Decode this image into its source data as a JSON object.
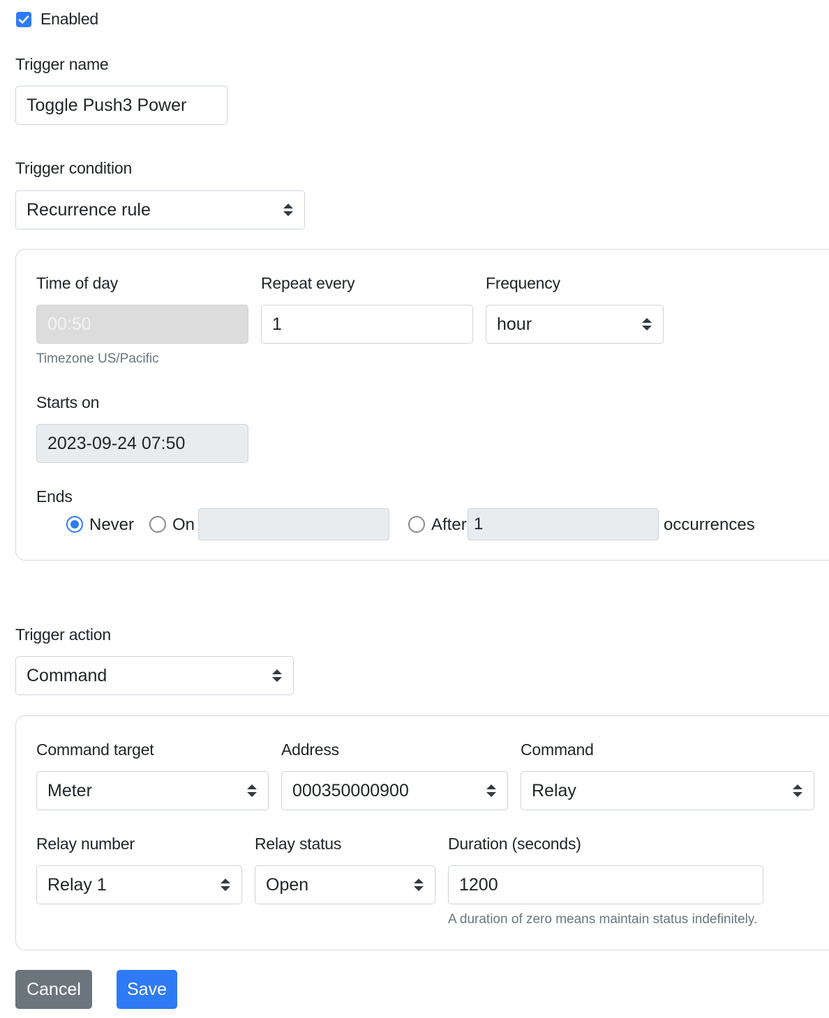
{
  "enabled": {
    "label": "Enabled",
    "checked": true
  },
  "trigger_name": {
    "label": "Trigger name",
    "value": "Toggle Push3 Power"
  },
  "trigger_condition": {
    "label": "Trigger condition",
    "value": "Recurrence rule",
    "time_of_day": {
      "label": "Time of day",
      "value": "00:50",
      "help": "Timezone US/Pacific"
    },
    "repeat_every": {
      "label": "Repeat every",
      "value": "1"
    },
    "frequency": {
      "label": "Frequency",
      "value": "hour"
    },
    "starts_on": {
      "label": "Starts on",
      "value": "2023-09-24 07:50"
    },
    "ends": {
      "label": "Ends",
      "never_label": "Never",
      "on_label": "On",
      "on_value": "",
      "after_label": "After",
      "after_value": "1",
      "occurrences_label": "occurrences",
      "selected": "never"
    }
  },
  "trigger_action": {
    "label": "Trigger action",
    "value": "Command",
    "command_target": {
      "label": "Command target",
      "value": "Meter"
    },
    "address": {
      "label": "Address",
      "value": "000350000900"
    },
    "command": {
      "label": "Command",
      "value": "Relay"
    },
    "relay_number": {
      "label": "Relay number",
      "value": "Relay 1"
    },
    "relay_status": {
      "label": "Relay status",
      "value": "Open"
    },
    "duration": {
      "label": "Duration (seconds)",
      "value": "1200",
      "help": "A duration of zero means maintain status indefinitely."
    }
  },
  "buttons": {
    "cancel": "Cancel",
    "save": "Save"
  },
  "colors": {
    "primary": "#2f7bf5",
    "secondary": "#6c757d",
    "disabled_bg": "#e9ecef",
    "border": "#ced4da"
  },
  "icons": {
    "select_caret": "sort-caret-icon",
    "checkbox": "check-icon"
  }
}
